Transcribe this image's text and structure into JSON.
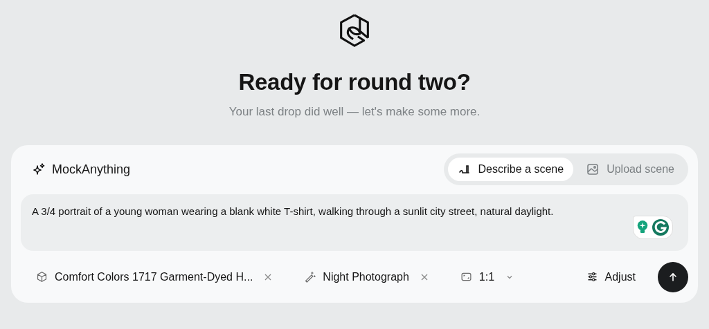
{
  "hero": {
    "title": "Ready for round two?",
    "subtitle": "Your last drop did well — let's make some more."
  },
  "composer": {
    "brand": "MockAnything",
    "modes": [
      {
        "label": "Describe a scene",
        "kind": "describe",
        "selected": true
      },
      {
        "label": "Upload scene",
        "kind": "upload",
        "selected": false
      }
    ],
    "prompt": {
      "value": "A 3/4 portrait of a young woman wearing a blank white T-shirt, walking through a sunlit city street, natural daylight."
    },
    "chips": [
      {
        "label": "Comfort Colors 1717 Garment-Dyed H...",
        "kind": "product"
      },
      {
        "label": "Night Photograph",
        "kind": "style"
      },
      {
        "label": "1:1",
        "kind": "aspect"
      }
    ],
    "adjust": "Adjust"
  }
}
